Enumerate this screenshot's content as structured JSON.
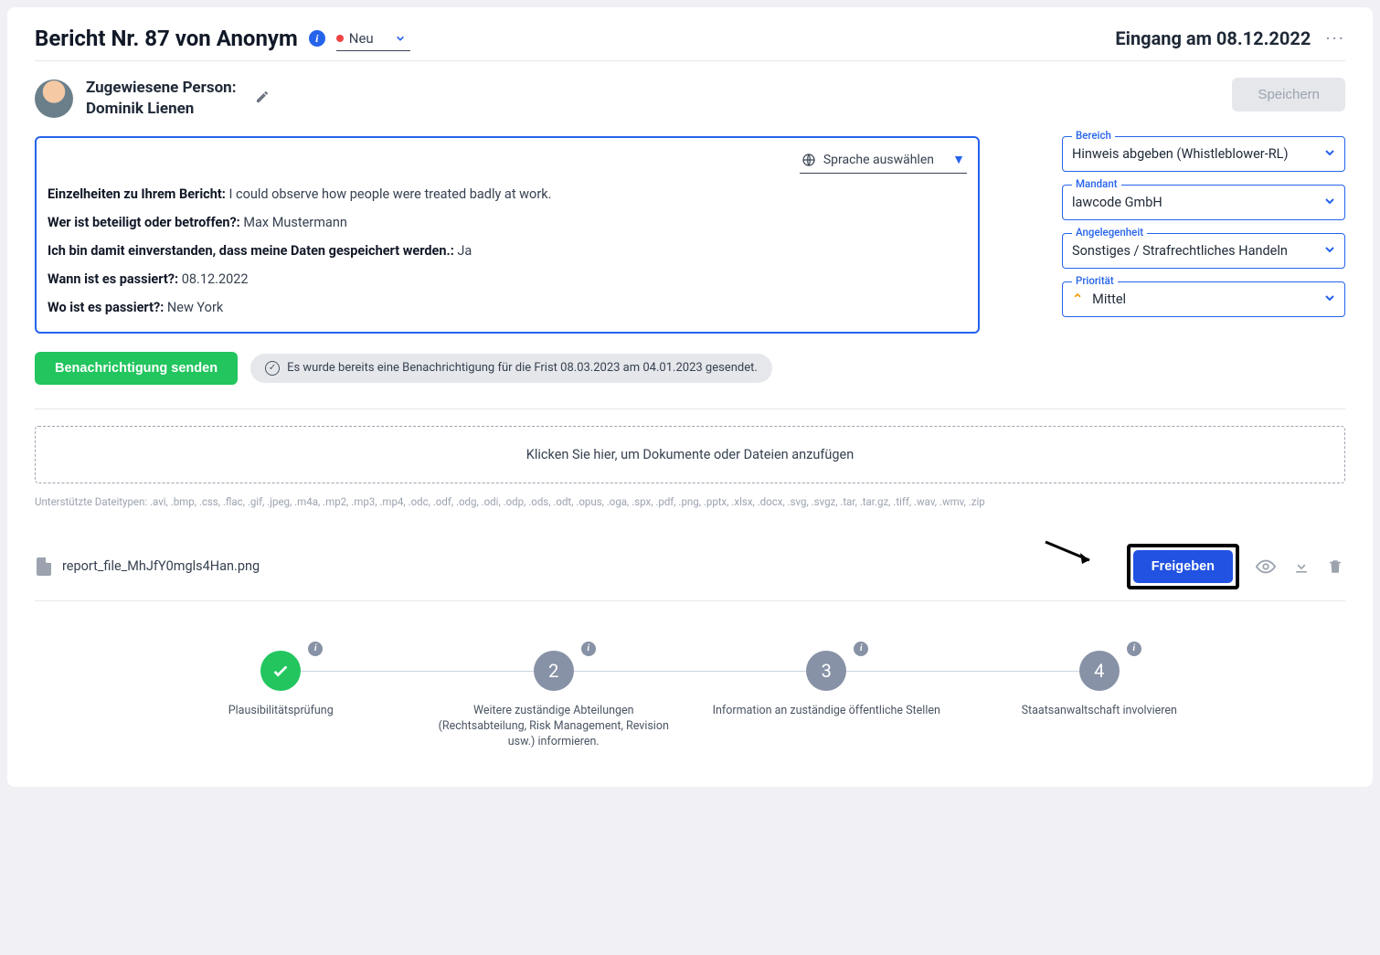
{
  "header": {
    "title": "Bericht Nr. 87 von Anonym",
    "status": "Neu",
    "date_label": "Eingang am 08.12.2022"
  },
  "assigned": {
    "label": "Zugewiesene Person:",
    "name": "Dominik Lienen",
    "save_label": "Speichern"
  },
  "details": {
    "lang_select": "Sprache auswählen",
    "q1_label": "Einzelheiten zu Ihrem Bericht:",
    "q1_value": "I could observe how people were treated badly at work.",
    "q2_label": "Wer ist beteiligt oder betroffen?:",
    "q2_value": "Max Mustermann",
    "q3_label": "Ich bin damit einverstanden, dass meine Daten gespeichert werden.:",
    "q3_value": "Ja",
    "q4_label": "Wann ist es passiert?:",
    "q4_value": "08.12.2022",
    "q5_label": "Wo ist es passiert?:",
    "q5_value": "New York"
  },
  "side": {
    "bereich": {
      "legend": "Bereich",
      "value": "Hinweis abgeben (Whistleblower-RL)"
    },
    "mandant": {
      "legend": "Mandant",
      "value": "lawcode GmbH"
    },
    "angelegenheit": {
      "legend": "Angelegenheit",
      "value": "Sonstiges / Strafrechtliches Handeln"
    },
    "prioritaet": {
      "legend": "Priorität",
      "value": "Mittel"
    }
  },
  "notify": {
    "button": "Benachrichtigung senden",
    "pill": "Es wurde bereits eine Benachrichtigung für die Frist 08.03.2023 am 04.01.2023 gesendet."
  },
  "upload": {
    "dropzone": "Klicken Sie hier, um Dokumente oder Dateien anzufügen",
    "filetypes": "Unterstützte Dateitypen: .avi, .bmp, .css, .flac, .gif, .jpeg, .m4a, .mp2, .mp3, .mp4, .odc, .odf, .odg, .odi, .odp, .ods, .odt, .opus, .oga, .spx, .pdf, .png, .pptx, .xlsx, .docx, .svg, .svgz, .tar, .tar.gz, .tiff, .wav, .wmv, .zip"
  },
  "file": {
    "name": "report_file_MhJfY0mgls4Han.png",
    "release_label": "Freigeben"
  },
  "steps": {
    "s1": "Plausibilitätsprüfung",
    "s2": "Weitere zuständige Abteilungen (Rechtsabteilung, Risk Management, Revision usw.) informieren.",
    "s3": "Information an zuständige öffentliche Stellen",
    "s4": "Staatsanwaltschaft involvieren"
  }
}
